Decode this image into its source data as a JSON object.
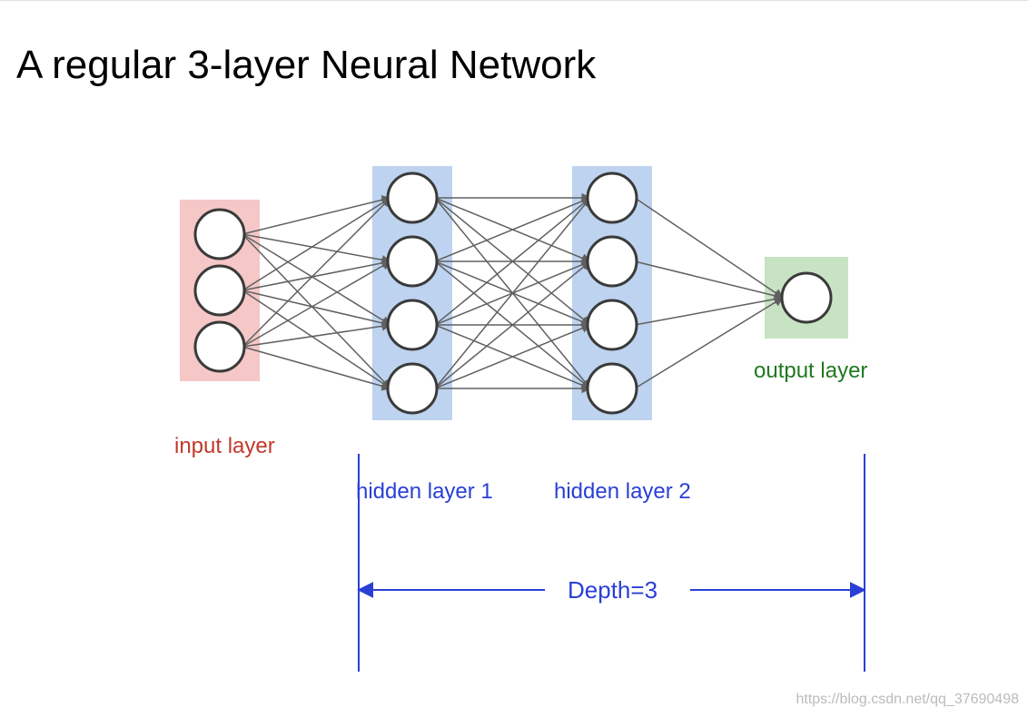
{
  "title": "A regular 3-layer Neural Network",
  "layers": {
    "input": {
      "label": "input layer",
      "color": "#c0392b",
      "bg": "#f5c7c7",
      "count": 3
    },
    "hidden1": {
      "label": "hidden layer 1",
      "color": "#2a3fd6",
      "bg": "#bdd3ef",
      "count": 4
    },
    "hidden2": {
      "label": "hidden layer 2",
      "color": "#2a3fd6",
      "bg": "#bdd3ef",
      "count": 4
    },
    "output": {
      "label": "output layer",
      "color": "#1f7a1f",
      "bg": "#c8e3c3",
      "count": 1
    }
  },
  "depth_label": "Depth=3",
  "depth_value": 3,
  "watermark": "https://blog.csdn.net/qq_37690498",
  "colors": {
    "node_stroke": "#3a3a3a",
    "edge": "#606060",
    "depth_line": "#2a3fd6"
  }
}
